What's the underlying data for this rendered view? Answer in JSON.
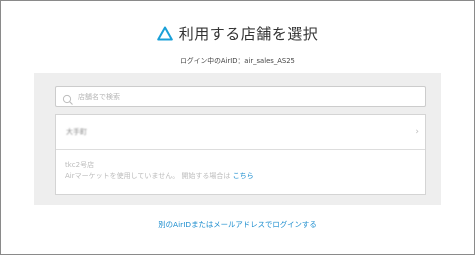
{
  "header": {
    "title": "利用する店舗を選択",
    "logo_icon": "air-triangle-icon",
    "accent": "#1aa0d8"
  },
  "login_info": "ログイン中のAirID：air_sales_AS25",
  "search": {
    "placeholder": "店舗名で検索"
  },
  "stores": [
    {
      "name": "大手町"
    },
    {
      "name": "tkc2号店",
      "note_prefix": "Airマーケットを使用していません。 開始する場合は ",
      "note_link": "こちら"
    }
  ],
  "footer": {
    "switch_account_link": "別のAirIDまたはメールアドレスでログインする"
  },
  "colors": {
    "link": "#1a8cce",
    "panel_bg": "#eeeeee"
  }
}
